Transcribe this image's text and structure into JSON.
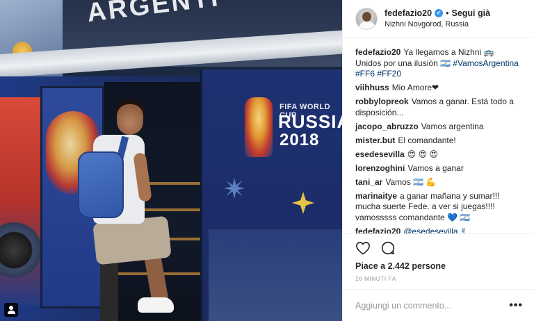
{
  "post": {
    "username": "fedefazio20",
    "verified_mark": "✔",
    "separator": "•",
    "follow_label": "Segui già",
    "location": "Nizhni Novgorod, Russia"
  },
  "photo": {
    "bus_text": "ARGENTI",
    "wc_line1": "FIFA WORLD CUP",
    "wc_line2": "RUSSIA",
    "wc_line3": "2018"
  },
  "comments": [
    {
      "user": "fedefazio20",
      "text": "Ya llegamos a Nizhni 🚌\nUnidos por una ilusión 🇦🇷",
      "tags": "#VamosArgentina #FF6 #FF20"
    },
    {
      "user": "viihhuss",
      "text": "Mio Amore❤"
    },
    {
      "user": "robbylopreok",
      "text": "Vamos a ganar. Está todo a disposición..."
    },
    {
      "user": "jacopo_abruzzo",
      "text": "Vamos argentina"
    },
    {
      "user": "mister.but",
      "text": "El comandante!"
    },
    {
      "user": "esedesevilla",
      "text": "😍 😍 😍"
    },
    {
      "user": "lorenzoghini",
      "text": "Vamos a ganar"
    },
    {
      "user": "tani_ar",
      "text": "Vamos 🇦🇷 💪"
    },
    {
      "user": "marinaitye",
      "text": "a ganar mañana y sumar!!!\nmucha suerte Fede. a ver si juegas!!!!\nvamosssss comandante 💙 🇦🇷"
    },
    {
      "user": "fedefazio20",
      "text": "",
      "tags": "@esedesevilla ✌"
    }
  ],
  "likes_label": "Piace a 2.442 persone",
  "time_label": "26 MINUTI FA",
  "comment_input": {
    "placeholder": "Aggiungi un commento..."
  },
  "more_label": "•••",
  "icons": {
    "like": "heart-icon",
    "comment": "comment-icon",
    "tag": "user-tag-icon",
    "options": "more-options-icon"
  },
  "colors": {
    "link": "#003569",
    "verified": "#3897f0",
    "border": "#efefef",
    "muted": "#999999"
  }
}
